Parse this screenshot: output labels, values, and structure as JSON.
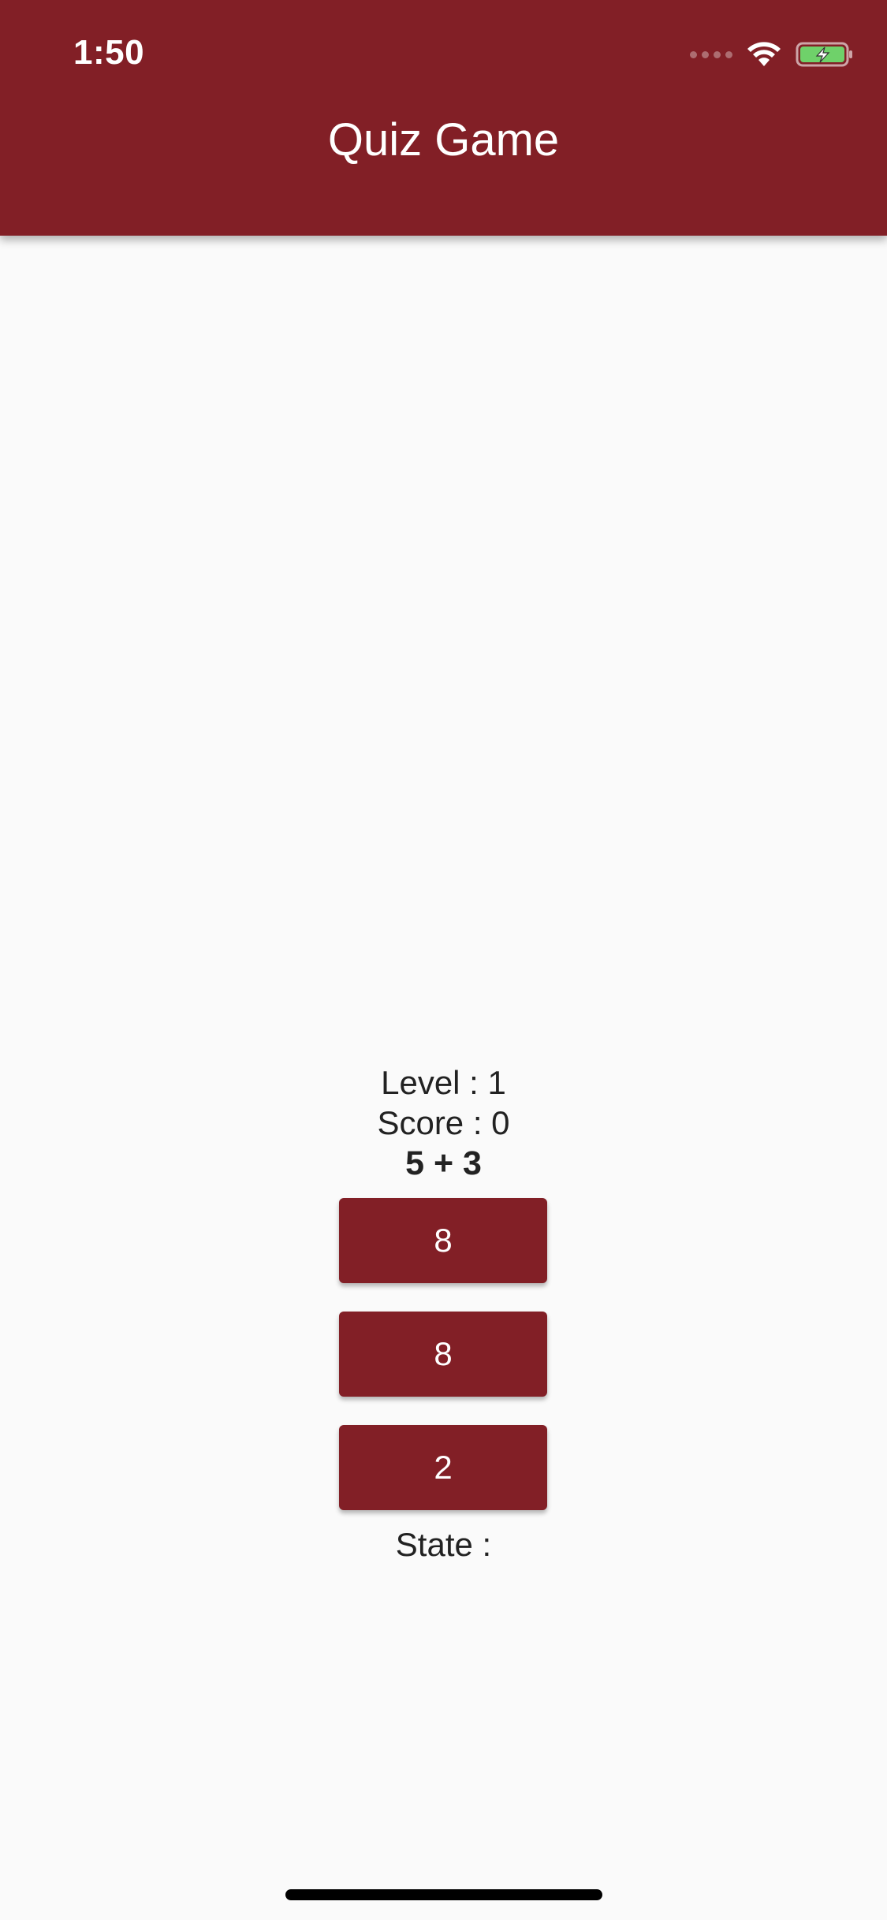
{
  "status_bar": {
    "time": "1:50"
  },
  "app_bar": {
    "title": "Quiz Game",
    "color": "#821f26"
  },
  "quiz": {
    "level_text": "Level : 1",
    "score_text": "Score : 0",
    "question": "5 + 3",
    "answers": [
      "8",
      "8",
      "2"
    ],
    "state_text": "State :"
  },
  "icons": {
    "signal": "cellular-signal-icon",
    "wifi": "wifi-icon",
    "battery": "battery-charging-icon"
  }
}
